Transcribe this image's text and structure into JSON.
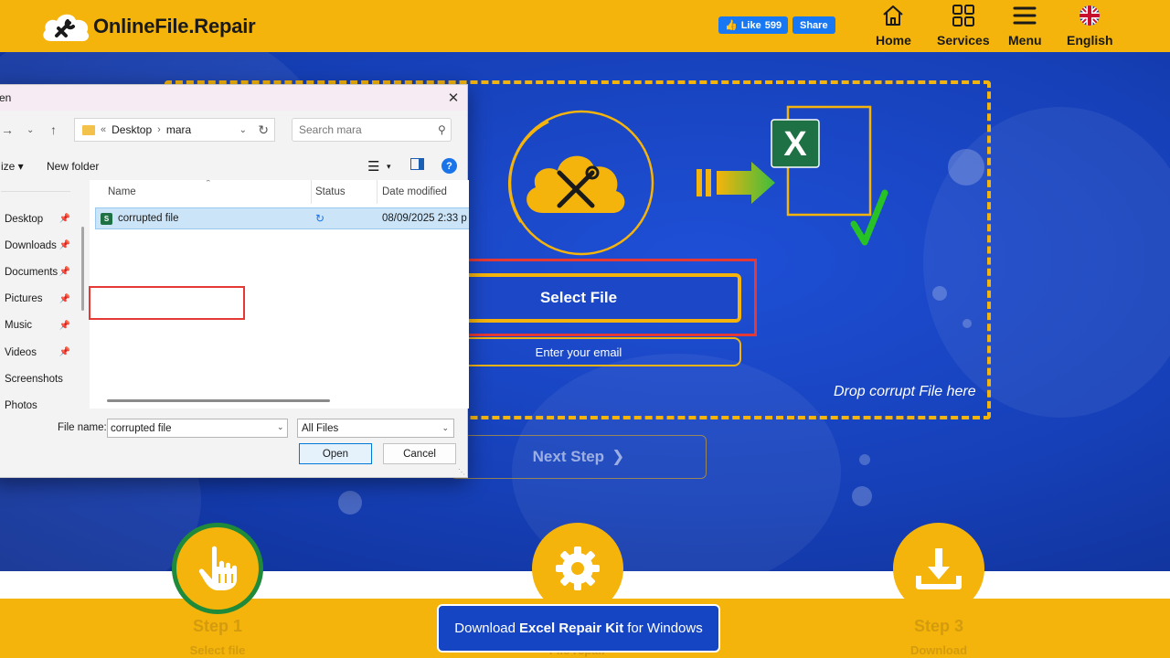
{
  "header": {
    "brand": "OnlineFile.Repair",
    "fb_like_label": "Like",
    "fb_like_count": "599",
    "fb_share_label": "Share",
    "nav": [
      {
        "label": "Home",
        "icon": "home-icon"
      },
      {
        "label": "Services",
        "icon": "grid-icon"
      },
      {
        "label": "Menu",
        "icon": "hamburger-icon"
      },
      {
        "label": "English",
        "icon": "uk-flag-icon"
      }
    ]
  },
  "hero": {
    "select_file_label": "Select File",
    "email_placeholder": "Enter your email",
    "drop_hint": "Drop corrupt File here",
    "next_step_label": "Next Step",
    "excel_letter": "X"
  },
  "steps": [
    {
      "label": "Step 1",
      "sub": "Select file",
      "icon": "pointer-hand-icon"
    },
    {
      "label": "",
      "sub": "File repair",
      "icon": "gear-icon"
    },
    {
      "label": "Step 3",
      "sub": "Download",
      "icon": "download-icon"
    }
  ],
  "download_kit": {
    "prefix": "Download",
    "product": "Excel Repair Kit",
    "suffix": "for Windows"
  },
  "dialog": {
    "title": "en",
    "breadcrumb": [
      "Desktop",
      "mara"
    ],
    "search_placeholder": "Search mara",
    "organize_label": "ize",
    "new_folder_label": "New folder",
    "columns": [
      "Name",
      "Status",
      "Date modified"
    ],
    "sidebar": [
      {
        "label": "Desktop"
      },
      {
        "label": "Downloads"
      },
      {
        "label": "Documents"
      },
      {
        "label": "Pictures"
      },
      {
        "label": "Music"
      },
      {
        "label": "Videos"
      },
      {
        "label": "Screenshots"
      },
      {
        "label": "Photos"
      }
    ],
    "files": [
      {
        "name": "corrupted file",
        "date": "08/09/2025 2:33 p"
      }
    ],
    "file_name_label": "File name:",
    "file_name_value": "corrupted file",
    "file_type": "All Files",
    "open_label": "Open",
    "cancel_label": "Cancel"
  },
  "colors": {
    "brand_yellow": "#f5b40b",
    "hero_blue": "#1a44c0",
    "highlight_red": "#e53935",
    "excel_green": "#1e7145"
  }
}
